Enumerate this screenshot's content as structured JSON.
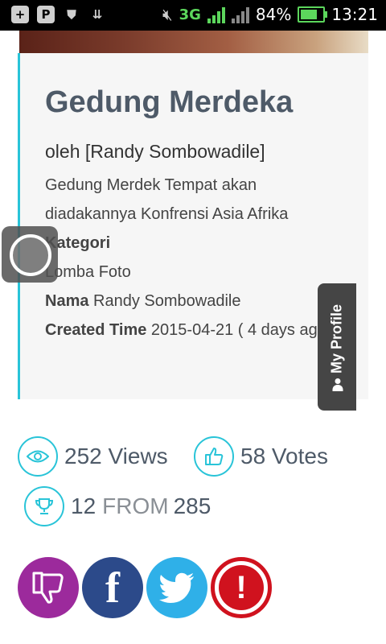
{
  "status_bar": {
    "left_icons": [
      "add-icon",
      "p-icon",
      "shield-icon",
      "download-icon"
    ],
    "network": "3G",
    "battery": "84%",
    "time": "13:21"
  },
  "post": {
    "title": "Gedung Merdeka",
    "author": "oleh [Randy Sombowadile]",
    "description": "Gedung Merdek Tempat akan diadakannya Konfrensi Asia Afrika",
    "kategori_label": "Kategori",
    "kategori_value": "Lomba Foto",
    "nama_label": "Nama",
    "nama_value": "Randy Sombowadile",
    "created_label": "Created Time",
    "created_value": "2015-04-21 ( 4 days ago )"
  },
  "profile_tab": {
    "label": "My Profile"
  },
  "stats": {
    "views": "252 Views",
    "votes": "58 Votes",
    "rank_num": "12",
    "rank_from": "FROM",
    "rank_total": "285"
  },
  "share": {
    "facebook_letter": "f",
    "report_symbol": "!"
  },
  "colors": {
    "accent": "#29c4d8",
    "dislike": "#9c2a9c",
    "facebook": "#2c4a8a",
    "twitter": "#2fb0e8",
    "report": "#d0121e"
  }
}
